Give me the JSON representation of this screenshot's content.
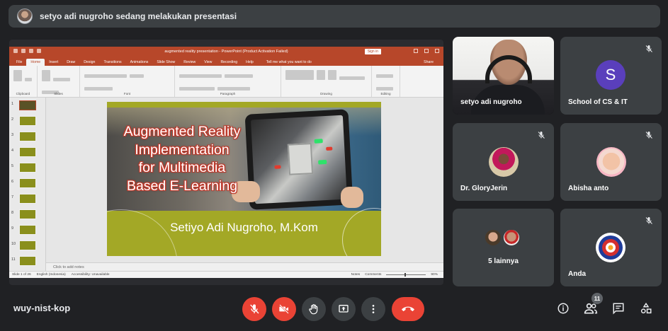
{
  "banner": {
    "text": "setyo adi nugroho sedang melakukan presentasi"
  },
  "powerpoint": {
    "window_title": "augmented reality presentation  -  PowerPoint (Product Activation Failed)",
    "sign_in": "Sign in",
    "menu_tabs": [
      "File",
      "Home",
      "Insert",
      "Draw",
      "Design",
      "Transitions",
      "Animations",
      "Slide Show",
      "Review",
      "View",
      "Recording",
      "Help"
    ],
    "tell_me": "Tell me what you want to do",
    "share": "Share",
    "ribbon_groups": [
      "Clipboard",
      "Slides",
      "Font",
      "Paragraph",
      "Drawing",
      "Editing"
    ],
    "slide_numbers": [
      "1",
      "2",
      "3",
      "4",
      "5",
      "6",
      "7",
      "8",
      "9",
      "10",
      "11"
    ],
    "notes_placeholder": "Click to add notes",
    "status": {
      "slide": "Slide 1 of 26",
      "language": "English (Indonesia)",
      "accessibility": "Accessibility: Unavailable",
      "notes": "Notes",
      "comments": "Comments",
      "zoom": "90%"
    },
    "slide": {
      "title_lines": [
        "Augmented Reality",
        "Implementation",
        "for Multimedia",
        "Based E-Learning"
      ],
      "author": "Setiyo Adi Nugroho, M.Kom"
    }
  },
  "participants": [
    {
      "name": "setyo adi nugroho",
      "type": "video"
    },
    {
      "name": "School of CS & IT",
      "type": "letter",
      "letter": "S",
      "color": "#5a3fbc"
    },
    {
      "name": "Dr. GloryJerin",
      "type": "photo"
    },
    {
      "name": "Abisha anto",
      "type": "photo"
    },
    {
      "name": "5 lainnya",
      "type": "group"
    },
    {
      "name": "Anda",
      "type": "logo"
    }
  ],
  "bottom_bar": {
    "meeting_code": "wuy-nist-kop",
    "participant_count": "11"
  },
  "colors": {
    "background": "#202124",
    "tile": "#3c4043",
    "danger": "#ea4335",
    "ppt_accent": "#b7472a",
    "slide_green": "#a3a826"
  }
}
